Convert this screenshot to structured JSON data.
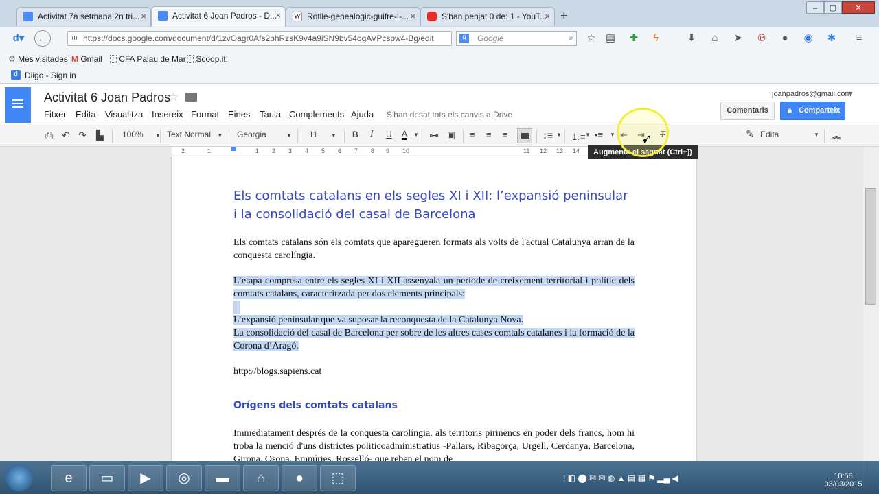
{
  "browser": {
    "tabs": [
      {
        "label": "Activitat 7a setmana 2n tri...",
        "icon": "docs-icon",
        "color": "#4a8af4"
      },
      {
        "label": "Activitat 6 Joan Padros - D...",
        "icon": "docs-icon",
        "color": "#4a8af4"
      },
      {
        "label": "Rotlle-genealogic-guifre-I-...",
        "icon": "wikipedia-icon",
        "color": "#ffffff"
      },
      {
        "label": "S'han penjat 0 de: 1 - YouT...",
        "icon": "youtube-icon",
        "color": "#e52d27"
      }
    ],
    "url": "https://docs.google.com/document/d/1zvOagr0Afs2bhRzsK9v4a9iSN9bv54ogAVPcspw4-Bg/edit",
    "search_placeholder": "Google",
    "bookmarks": [
      "Més visitades",
      "Gmail",
      "CFA Palau de Mar",
      "Scoop.it!"
    ],
    "diigo": "Diigo - Sign in"
  },
  "docs": {
    "title": "Activitat 6 Joan Padros",
    "user_email": "joanpadros@gmail.com",
    "menus": [
      "Fitxer",
      "Edita",
      "Visualitza",
      "Insereix",
      "Format",
      "Eines",
      "Taula",
      "Complements",
      "Ajuda"
    ],
    "save_status": "S'han desat tots els canvis a Drive",
    "comments_label": "Comentaris",
    "share_label": "Comparteix",
    "accent": "#4285f4"
  },
  "toolbar": {
    "zoom": "100%",
    "style": "Text Normal",
    "font": "Georgia",
    "size": "11",
    "edit_mode": "Edita",
    "tooltip": "Augmenta el sagnat (Ctrl+])"
  },
  "ruler": [
    "2",
    "1",
    "1",
    "2",
    "3",
    "4",
    "5",
    "6",
    "7",
    "8",
    "9",
    "10",
    "11",
    "12",
    "13",
    "14"
  ],
  "document": {
    "heading": "Els comtats catalans en els segles XI i XII: l’expansió peninsular i la consolidació del casal de Barcelona",
    "p1": "Els comtats catalans són els comtats que aparegueren formats als volts de l'actual Catalunya arran de la conquesta carolíngia.",
    "p2": "L’etapa compresa entre els segles XI i XII assenyala un període de creixement territorial i polític dels comtats catalans, caracteritzada per dos elements principals:",
    "p3": "L’expansió peninsular que va suposar la reconquesta de la Catalunya Nova.",
    "p4": "La consolidació del casal de Barcelona per sobre de les altres cases comtals catalanes i la formació de la Corona d’Aragó.",
    "link": "http://blogs.sapiens.cat",
    "subheading": "Orígens dels comtats catalans",
    "p5": "Immediatament després de la conquesta carolíngia, als territoris pirinencs en poder dels francs, hom hi troba la menció d'uns districtes politicoadministratius -Pallars, Ribagorça, Urgell, Cerdanya, Barcelona, Girona, Osona, Empúries, Rosselló- que reben el nom de"
  },
  "taskbar": {
    "time": "10:58",
    "date": "03/03/2015"
  }
}
